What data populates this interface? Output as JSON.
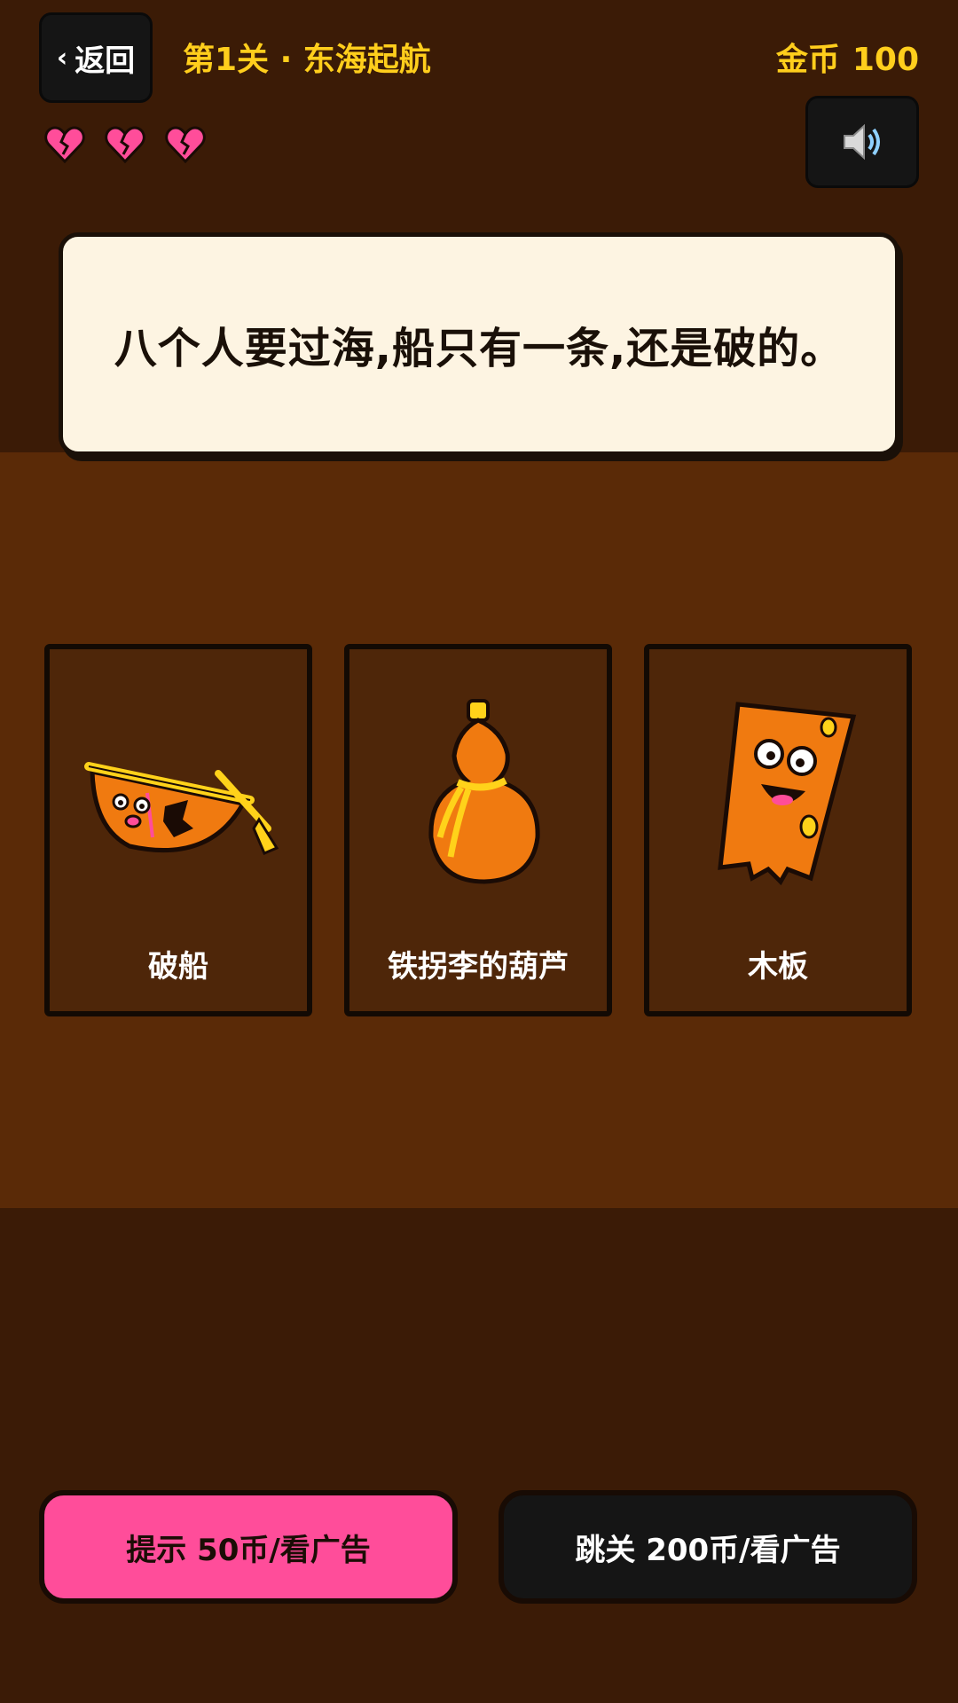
{
  "header": {
    "back_label": "返回",
    "level_title": "第1关 · 东海起航",
    "coins_label": "金币",
    "coins_value": "100"
  },
  "lives": {
    "count": 3,
    "icon": "broken-heart-icon",
    "color": "#ff4d9a"
  },
  "sound_icon": "speaker-icon",
  "question": {
    "text": "八个人要过海,船只有一条,还是破的。"
  },
  "options": [
    {
      "label": "破船",
      "icon": "broken-boat-icon"
    },
    {
      "label": "铁拐李的葫芦",
      "icon": "gourd-icon"
    },
    {
      "label": "木板",
      "icon": "plank-icon"
    }
  ],
  "actions": {
    "hint_label": "提示 50币/看广告",
    "skip_label": "跳关 200币/看广告"
  },
  "colors": {
    "accent": "#ffce1c",
    "hint": "#ff4d9a",
    "background_dark": "#3b1b06",
    "background_mid": "#5a2a07"
  }
}
